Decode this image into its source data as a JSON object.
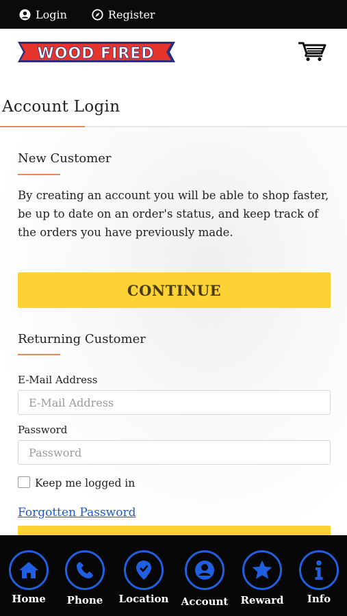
{
  "topbar": {
    "login_label": "Login",
    "register_label": "Register"
  },
  "header": {
    "logo_text": "WOOD FIRED",
    "cart_icon": "cart-icon"
  },
  "page": {
    "title": "Account Login"
  },
  "new_customer": {
    "title": "New Customer",
    "description": "By creating an account you will be able to shop faster, be up to date on an order's status, and keep track of the orders you have previously made.",
    "continue_label": "CONTINUE"
  },
  "returning_customer": {
    "title": "Returning Customer",
    "email_label": "E-Mail Address",
    "email_placeholder": "E-Mail Address",
    "email_value": "",
    "password_label": "Password",
    "password_placeholder": "Password",
    "password_value": "",
    "keep_logged_label": "Keep me logged in",
    "keep_logged_checked": false,
    "forgot_label": "Forgotten Password"
  },
  "bottom_nav": {
    "items": [
      {
        "label": "Home",
        "icon": "home-icon"
      },
      {
        "label": "Phone",
        "icon": "phone-icon"
      },
      {
        "label": "Location",
        "icon": "location-icon"
      },
      {
        "label": "Account",
        "icon": "account-icon"
      },
      {
        "label": "Reward",
        "icon": "star-icon"
      },
      {
        "label": "Info",
        "icon": "info-icon"
      }
    ]
  },
  "colors": {
    "accent_yellow": "#fcd234",
    "accent_orange": "#e8875a",
    "link_blue": "#1a5bd8",
    "nav_blue": "#1f5fe0",
    "logo_red": "#e6362b",
    "logo_navy": "#2a2f80"
  }
}
